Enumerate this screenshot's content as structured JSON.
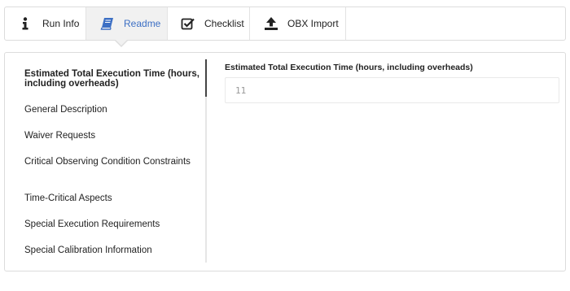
{
  "tabs": {
    "run_info": "Run Info",
    "readme": "Readme",
    "checklist": "Checklist",
    "obx_import": "OBX Import",
    "active": "readme",
    "accent_color": "#3c6fc4"
  },
  "sidebar": {
    "items": [
      "Estimated Total Execution Time (hours, including overheads)",
      "General Description",
      "Waiver Requests",
      "Critical Observing Condition Constraints",
      "Time-Critical Aspects",
      "Special Execution Requirements",
      "Special Calibration Information"
    ],
    "active_index": 0
  },
  "content": {
    "field_label": "Estimated Total Execution Time (hours, including overheads)",
    "field_value": "11"
  }
}
